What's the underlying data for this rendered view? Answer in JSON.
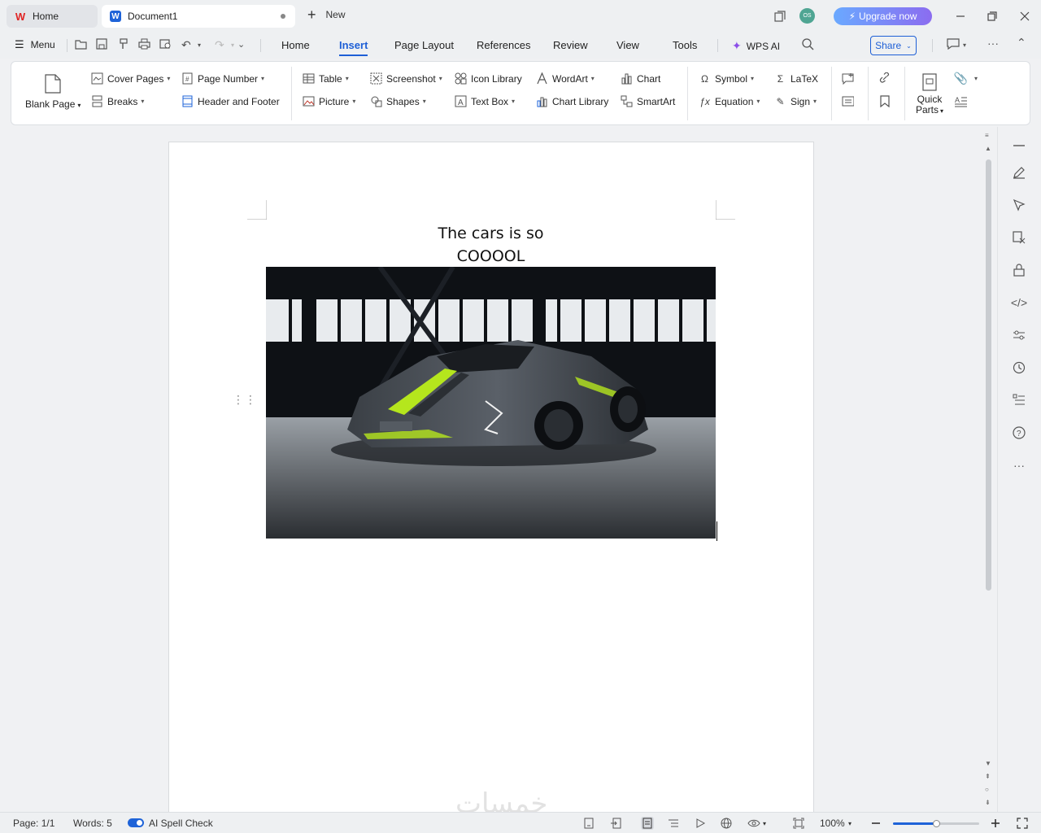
{
  "titlebar": {
    "home_tab": "Home",
    "doc_tab": "Document1",
    "new_tab": "New",
    "avatar_initials": "OS",
    "upgrade": "Upgrade now"
  },
  "menubar": {
    "menu": "Menu",
    "tabs": [
      "Home",
      "Insert",
      "Page Layout",
      "References",
      "Review",
      "View",
      "Tools"
    ],
    "active_tab": "Insert",
    "wps_ai": "WPS AI",
    "share": "Share"
  },
  "ribbon": {
    "blank_page": "Blank Page",
    "cover_pages": "Cover Pages",
    "breaks": "Breaks",
    "page_number": "Page Number",
    "header_footer": "Header and  Footer",
    "table": "Table",
    "picture": "Picture",
    "screenshot": "Screenshot",
    "shapes": "Shapes",
    "icon_library": "Icon  Library",
    "text_box": "Text Box",
    "wordart": "WordArt",
    "chart_library": "Chart  Library",
    "chart": "Chart",
    "smartart": "SmartArt",
    "symbol": "Symbol",
    "equation": "Equation",
    "latex": "LaTeX",
    "sign": "Sign",
    "quick_parts_1": "Quick",
    "quick_parts_2": "Parts"
  },
  "document": {
    "line1": "The cars is so",
    "line2": "COOOOL"
  },
  "status": {
    "page": "Page: 1/1",
    "words": "Words: 5",
    "spell": "AI Spell Check",
    "zoom": "100%",
    "zoom_level": 0.5
  },
  "colors": {
    "accent": "#1e5fd6",
    "upgrade_start": "#6aa9ff",
    "upgrade_end": "#8b6cf0",
    "car_stripe": "#b5e61d"
  }
}
